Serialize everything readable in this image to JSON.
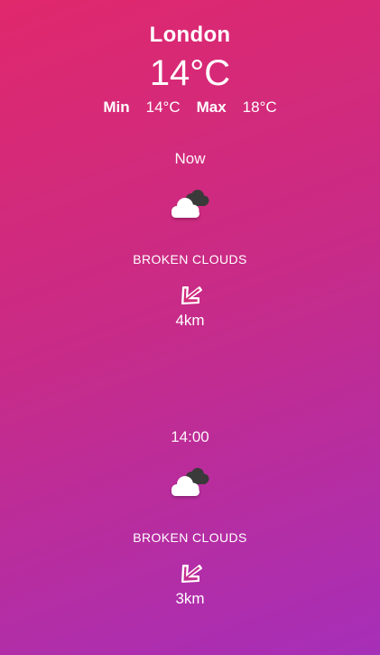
{
  "location": {
    "city": "London",
    "current_temp": "14°C",
    "min_label": "Min",
    "min_value": "14°C",
    "max_label": "Max",
    "max_value": "18°C"
  },
  "forecasts": [
    {
      "time": "Now",
      "icon": "broken-clouds-icon",
      "description": "BROKEN CLOUDS",
      "wind_icon": "wind-direction-arrow-icon",
      "wind": "4km"
    },
    {
      "time": "14:00",
      "icon": "broken-clouds-icon",
      "description": "BROKEN CLOUDS",
      "wind_icon": "wind-direction-arrow-icon",
      "wind": "3km"
    }
  ],
  "colors": {
    "gradient_start": "#e0286c",
    "gradient_end": "#a62fb8",
    "text": "#ffffff"
  }
}
